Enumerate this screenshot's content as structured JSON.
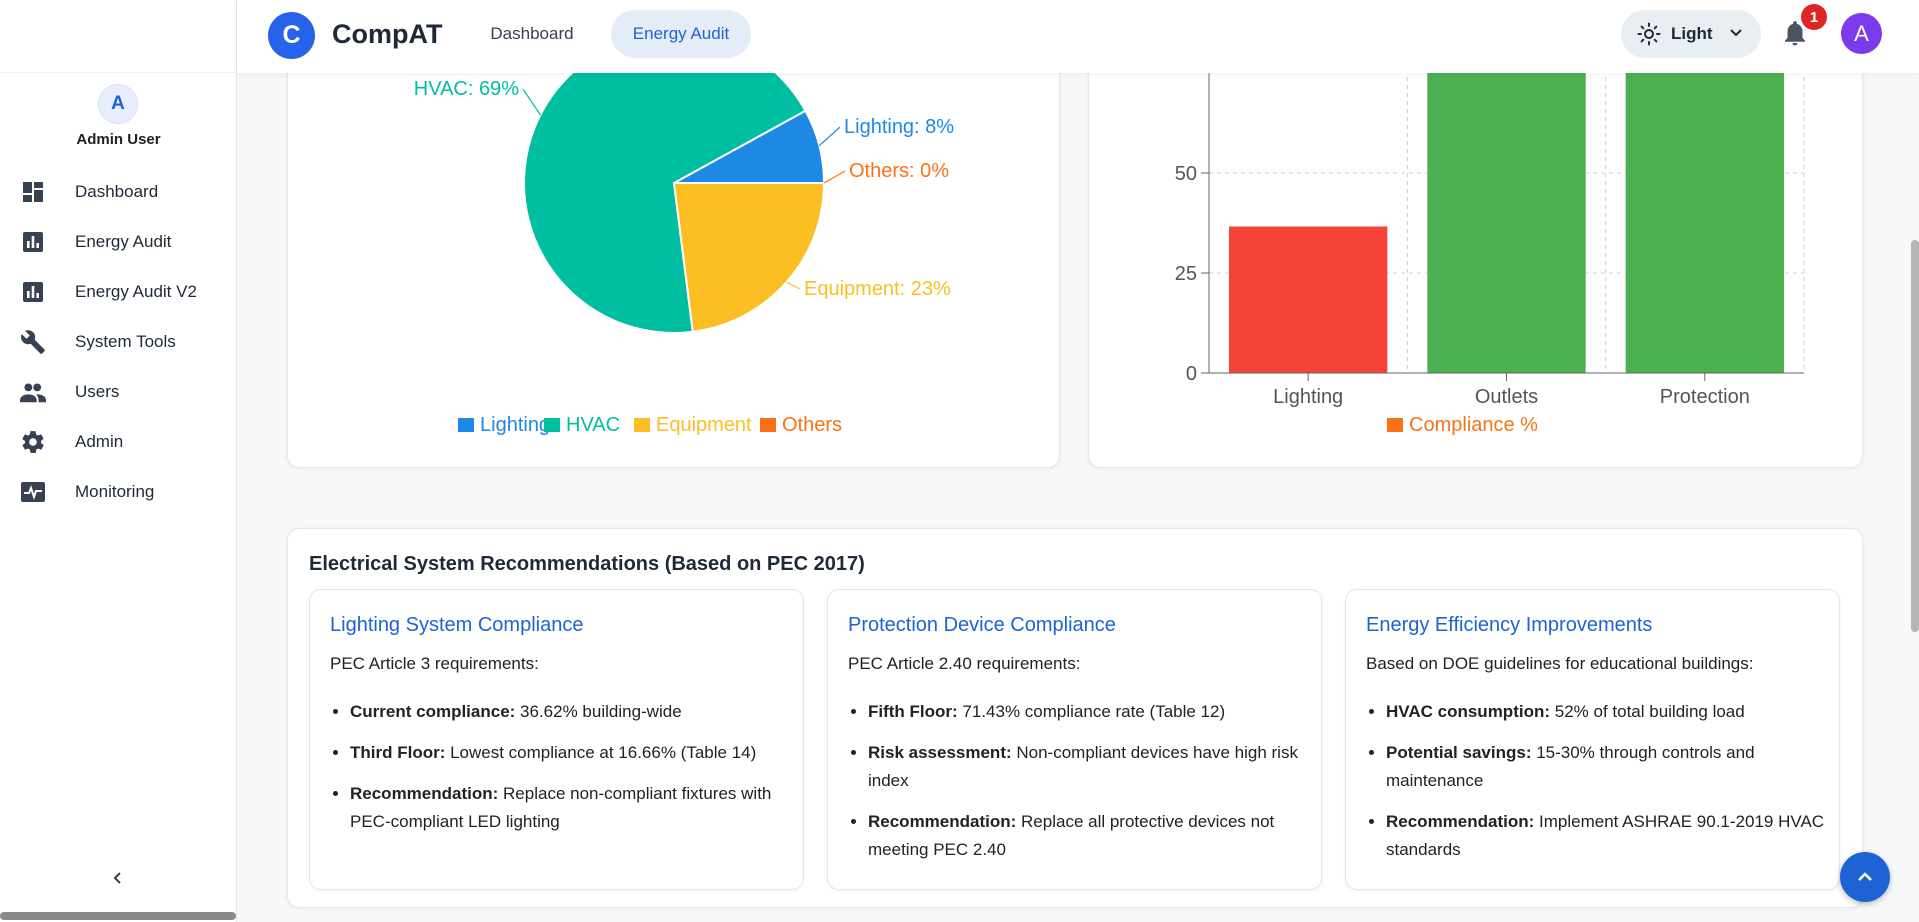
{
  "app": {
    "brand_letter": "C",
    "brand_name": "CompAT"
  },
  "topbar": {
    "tabs": [
      {
        "label": "Dashboard"
      },
      {
        "label": "Energy Audit"
      }
    ],
    "theme_label": "Light",
    "notification_count": "1",
    "avatar_letter": "A"
  },
  "sidebar": {
    "avatar_letter": "A",
    "user_name": "Admin User",
    "items": [
      {
        "label": "Dashboard",
        "icon": "dashboard-icon"
      },
      {
        "label": "Energy Audit",
        "icon": "bar-chart-icon"
      },
      {
        "label": "Energy Audit V2",
        "icon": "bar-chart-icon"
      },
      {
        "label": "System Tools",
        "icon": "wrench-icon"
      },
      {
        "label": "Users",
        "icon": "people-icon"
      },
      {
        "label": "Admin",
        "icon": "gear-icon"
      },
      {
        "label": "Monitoring",
        "icon": "monitoring-icon"
      }
    ]
  },
  "colors": {
    "lighting": "#1e88e5",
    "hvac": "#00bfa0",
    "equipment": "#fbbf24",
    "others": "#f97316",
    "bar_red": "#f44336",
    "bar_green": "#4caf50",
    "accent": "#1e63d6"
  },
  "chart_data": [
    {
      "type": "pie",
      "slices": [
        {
          "label": "Lighting",
          "value": 8,
          "text": "Lighting: 8%"
        },
        {
          "label": "HVAC",
          "value": 69,
          "text": "HVAC: 69%"
        },
        {
          "label": "Equipment",
          "value": 23,
          "text": "Equipment: 23%"
        },
        {
          "label": "Others",
          "value": 0,
          "text": "Others: 0%"
        }
      ],
      "legend": [
        "Lighting",
        "HVAC",
        "Equipment",
        "Others"
      ],
      "legend_position": "bottom"
    },
    {
      "type": "bar",
      "categories": [
        "Lighting",
        "Outlets",
        "Protection"
      ],
      "values": [
        36.62,
        100,
        100
      ],
      "series_name": "Compliance %",
      "yticks": [
        "0",
        "25",
        "50"
      ],
      "ylim": [
        0,
        75
      ],
      "grid": true,
      "legend_position": "bottom"
    }
  ],
  "recommendations": {
    "title": "Electrical System Recommendations (Based on PEC 2017)",
    "cards": [
      {
        "title": "Lighting System Compliance",
        "intro": "PEC Article 3 requirements:",
        "items": [
          {
            "label": "Current compliance:",
            "text": " 36.62% building-wide"
          },
          {
            "label": "Third Floor:",
            "text": " Lowest compliance at 16.66% (Table 14)"
          },
          {
            "label": "Recommendation:",
            "text": " Replace non-compliant fixtures with PEC-compliant LED lighting"
          }
        ]
      },
      {
        "title": "Protection Device Compliance",
        "intro": "PEC Article 2.40 requirements:",
        "items": [
          {
            "label": "Fifth Floor:",
            "text": " 71.43% compliance rate (Table 12)"
          },
          {
            "label": "Risk assessment:",
            "text": " Non-compliant devices have high risk index"
          },
          {
            "label": "Recommendation:",
            "text": " Replace all protective devices not meeting PEC 2.40"
          }
        ]
      },
      {
        "title": "Energy Efficiency Improvements",
        "intro": "Based on DOE guidelines for educational buildings:",
        "items": [
          {
            "label": "HVAC consumption:",
            "text": " 52% of total building load"
          },
          {
            "label": "Potential savings:",
            "text": " 15-30% through controls and maintenance"
          },
          {
            "label": "Recommendation:",
            "text": " Implement ASHRAE 90.1-2019 HVAC standards"
          }
        ]
      }
    ]
  }
}
